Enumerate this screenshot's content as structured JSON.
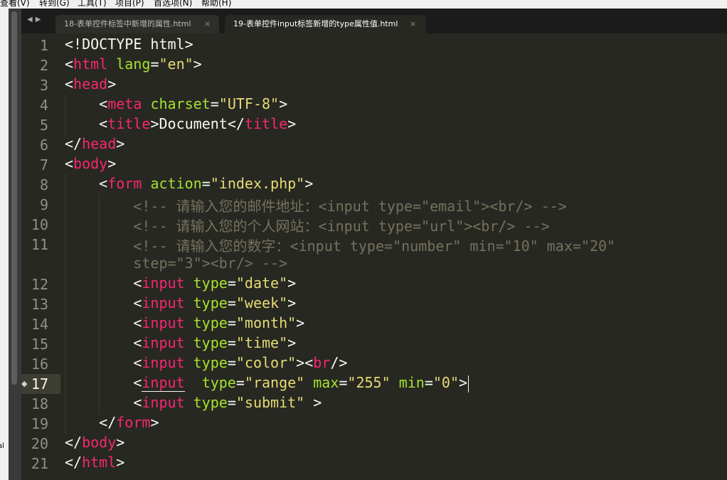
{
  "menubar": {
    "items": [
      "查看(V)",
      "转到(G)",
      "工具(T)",
      "项目(P)",
      "首选项(N)",
      "帮助(H)"
    ]
  },
  "side_fragment": "al",
  "tabs": [
    {
      "title": "18-表单控件标签中新增的属性.html",
      "active": false,
      "close": "×"
    },
    {
      "title": "19-表单控件input标签新增的type属性值.html",
      "active": true,
      "close": "×"
    }
  ],
  "nav": {
    "back_icon": "◀",
    "forward_icon": "▶"
  },
  "editor": {
    "line_numbers": [
      "1",
      "2",
      "3",
      "4",
      "5",
      "6",
      "7",
      "8",
      "9",
      "10",
      "11",
      "",
      "12",
      "13",
      "14",
      "15",
      "16",
      "17",
      "18",
      "19",
      "20",
      "21"
    ],
    "current_line": "17",
    "lines": [
      [
        [
          "punc",
          "<!DOCTYPE html>"
        ]
      ],
      [
        [
          "punc",
          "<"
        ],
        [
          "tag",
          "html"
        ],
        [
          "text",
          " "
        ],
        [
          "attr",
          "lang"
        ],
        [
          "punc",
          "="
        ],
        [
          "str",
          "\"en\""
        ],
        [
          "punc",
          ">"
        ]
      ],
      [
        [
          "punc",
          "<"
        ],
        [
          "tag",
          "head"
        ],
        [
          "punc",
          ">"
        ]
      ],
      [
        [
          "text",
          "    "
        ],
        [
          "punc",
          "<"
        ],
        [
          "tag",
          "meta"
        ],
        [
          "text",
          " "
        ],
        [
          "attr",
          "charset"
        ],
        [
          "punc",
          "="
        ],
        [
          "str",
          "\"UTF-8\""
        ],
        [
          "punc",
          ">"
        ]
      ],
      [
        [
          "text",
          "    "
        ],
        [
          "punc",
          "<"
        ],
        [
          "tag",
          "title"
        ],
        [
          "punc",
          ">"
        ],
        [
          "text",
          "Document"
        ],
        [
          "punc",
          "</"
        ],
        [
          "tag",
          "title"
        ],
        [
          "punc",
          ">"
        ]
      ],
      [
        [
          "punc",
          "</"
        ],
        [
          "tag",
          "head"
        ],
        [
          "punc",
          ">"
        ]
      ],
      [
        [
          "punc",
          "<"
        ],
        [
          "tag",
          "body"
        ],
        [
          "punc",
          ">"
        ]
      ],
      [
        [
          "text",
          "    "
        ],
        [
          "punc",
          "<"
        ],
        [
          "tag",
          "form"
        ],
        [
          "text",
          " "
        ],
        [
          "attr",
          "action"
        ],
        [
          "punc",
          "="
        ],
        [
          "str",
          "\"index.php\""
        ],
        [
          "punc",
          ">"
        ]
      ],
      [
        [
          "text",
          "        "
        ],
        [
          "cmt",
          "<!-- 请输入您的邮件地址：<input type=\"email\"><br/> -->"
        ]
      ],
      [
        [
          "text",
          "        "
        ],
        [
          "cmt",
          "<!-- 请输入您的个人网站：<input type=\"url\"><br/> -->"
        ]
      ],
      [
        [
          "text",
          "        "
        ],
        [
          "cmt",
          "<!-- 请输入您的数字：<input type=\"number\" min=\"10\" max=\"20\""
        ]
      ],
      [
        [
          "text",
          "        "
        ],
        [
          "cmt",
          "step=\"3\"><br/> -->"
        ]
      ],
      [
        [
          "text",
          "        "
        ],
        [
          "punc",
          "<"
        ],
        [
          "tag",
          "input"
        ],
        [
          "text",
          " "
        ],
        [
          "attr",
          "type"
        ],
        [
          "punc",
          "="
        ],
        [
          "str",
          "\"date\""
        ],
        [
          "punc",
          ">"
        ]
      ],
      [
        [
          "text",
          "        "
        ],
        [
          "punc",
          "<"
        ],
        [
          "tag",
          "input"
        ],
        [
          "text",
          " "
        ],
        [
          "attr",
          "type"
        ],
        [
          "punc",
          "="
        ],
        [
          "str",
          "\"week\""
        ],
        [
          "punc",
          ">"
        ]
      ],
      [
        [
          "text",
          "        "
        ],
        [
          "punc",
          "<"
        ],
        [
          "tag",
          "input"
        ],
        [
          "text",
          " "
        ],
        [
          "attr",
          "type"
        ],
        [
          "punc",
          "="
        ],
        [
          "str",
          "\"month\""
        ],
        [
          "punc",
          ">"
        ]
      ],
      [
        [
          "text",
          "        "
        ],
        [
          "punc",
          "<"
        ],
        [
          "tag",
          "input"
        ],
        [
          "text",
          " "
        ],
        [
          "attr",
          "type"
        ],
        [
          "punc",
          "="
        ],
        [
          "str",
          "\"time\""
        ],
        [
          "punc",
          ">"
        ]
      ],
      [
        [
          "text",
          "        "
        ],
        [
          "punc",
          "<"
        ],
        [
          "tag",
          "input"
        ],
        [
          "text",
          " "
        ],
        [
          "attr",
          "type"
        ],
        [
          "punc",
          "="
        ],
        [
          "str",
          "\"color\""
        ],
        [
          "punc",
          "><"
        ],
        [
          "tag",
          "br"
        ],
        [
          "punc",
          "/>"
        ]
      ],
      [
        [
          "text",
          "        "
        ],
        [
          "punc",
          "<"
        ],
        [
          "tagul",
          "input"
        ],
        [
          "text",
          "  "
        ],
        [
          "attr",
          "type"
        ],
        [
          "punc",
          "="
        ],
        [
          "str",
          "\"range\""
        ],
        [
          "text",
          " "
        ],
        [
          "attr",
          "max"
        ],
        [
          "punc",
          "="
        ],
        [
          "str",
          "\"255\""
        ],
        [
          "text",
          " "
        ],
        [
          "attr",
          "min"
        ],
        [
          "punc",
          "="
        ],
        [
          "str",
          "\"0\""
        ],
        [
          "punc",
          ">"
        ]
      ],
      [
        [
          "text",
          "        "
        ],
        [
          "punc",
          "<"
        ],
        [
          "tag",
          "input"
        ],
        [
          "text",
          " "
        ],
        [
          "attr",
          "type"
        ],
        [
          "punc",
          "="
        ],
        [
          "str",
          "\"submit\""
        ],
        [
          "text",
          " "
        ],
        [
          "punc",
          ">"
        ]
      ],
      [
        [
          "text",
          "    "
        ],
        [
          "punc",
          "</"
        ],
        [
          "tag",
          "form"
        ],
        [
          "punc",
          ">"
        ]
      ],
      [
        [
          "punc",
          "</"
        ],
        [
          "tag",
          "body"
        ],
        [
          "punc",
          ">"
        ]
      ],
      [
        [
          "punc",
          "</"
        ],
        [
          "tag",
          "html"
        ],
        [
          "punc",
          ">"
        ]
      ]
    ]
  },
  "colors": {
    "background": "#272822",
    "tag": "#f92672",
    "attribute": "#a6e22e",
    "string": "#e6db74",
    "comment": "#75715e",
    "text": "#f8f8f2",
    "line_number": "#8f908a"
  },
  "icons": {
    "bookmark": "bookmark-icon",
    "close": "close-icon",
    "back": "back-arrow-icon",
    "forward": "forward-arrow-icon"
  }
}
